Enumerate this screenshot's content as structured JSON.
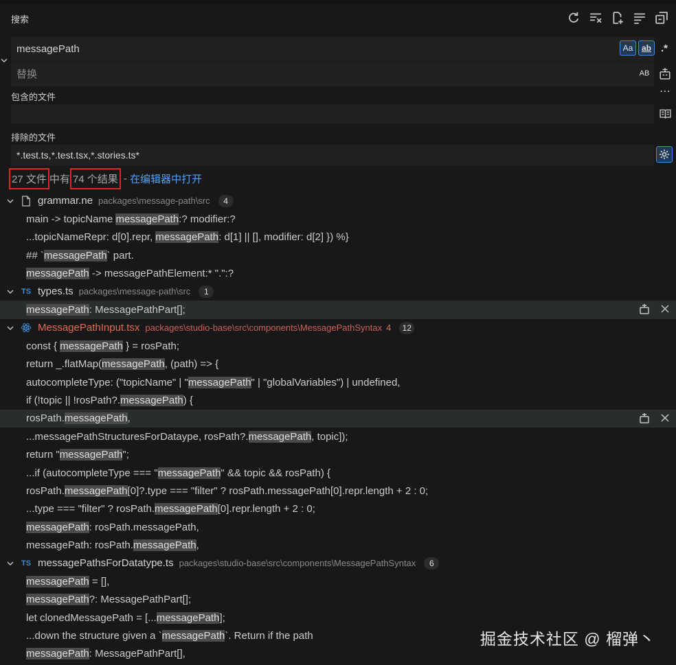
{
  "panel": {
    "title": "搜索"
  },
  "header_icons": [
    "refresh-icon",
    "clear-results-icon",
    "new-search-editor-icon",
    "view-as-tree-icon",
    "collapse-all-icon"
  ],
  "search": {
    "value": "messagePath",
    "opt_case": "Aa",
    "opt_word": "ab",
    "opt_regex": ".*"
  },
  "replace": {
    "placeholder": "替换",
    "opt_preserve_case": "AB"
  },
  "include": {
    "label": "包含的文件",
    "value": ""
  },
  "exclude": {
    "label": "排除的文件",
    "value": "*.test.ts,*.test.tsx,*.stories.ts*"
  },
  "summary": {
    "files": "27 文件",
    "middle": "中有",
    "results": "74 个结果",
    "sep": " - ",
    "open_link": "在编辑器中打开"
  },
  "files": [
    {
      "name": "grammar.ne",
      "path": "packages\\message-path\\src",
      "count": "4",
      "icon": "file-icon",
      "matches": [
        [
          [
            "main -> topicName ",
            false
          ],
          [
            "messagePath",
            true
          ],
          [
            ":? modifier:?",
            false
          ]
        ],
        [
          [
            "...topicNameRepr: d[0].repr, ",
            false
          ],
          [
            "messagePath",
            true
          ],
          [
            ": d[1] || [], modifier: d[2] }) %}",
            false
          ]
        ],
        [
          [
            "## `",
            false
          ],
          [
            "messagePath",
            true
          ],
          [
            "` part.",
            false
          ]
        ],
        [
          [
            "messagePath",
            true
          ],
          [
            " -> messagePathElement:* \".\":?",
            false
          ]
        ]
      ]
    },
    {
      "name": "types.ts",
      "path": "packages\\message-path\\src",
      "count": "1",
      "icon": "ts-icon",
      "icon_text": "TS",
      "matches": [
        [
          [
            "messagePath",
            true
          ],
          [
            ": MessagePathPart[];",
            false
          ]
        ]
      ]
    },
    {
      "name": "MessagePathInput.tsx",
      "path": "packages\\studio-base\\src\\components\\MessagePathSyntax",
      "mod": "4",
      "count": "12",
      "icon": "react-icon",
      "matches": [
        [
          [
            "const { ",
            false
          ],
          [
            "messagePath",
            true
          ],
          [
            " } = rosPath;",
            false
          ]
        ],
        [
          [
            "return _.flatMap(",
            false
          ],
          [
            "messagePath",
            true
          ],
          [
            ", (path) => {",
            false
          ]
        ],
        [
          [
            "autocompleteType: (\"topicName\" | \"",
            false
          ],
          [
            "messagePath",
            true
          ],
          [
            "\" | \"globalVariables\") | undefined,",
            false
          ]
        ],
        [
          [
            "if (!topic || !rosPath?.",
            false
          ],
          [
            "messagePath",
            true
          ],
          [
            ") {",
            false
          ]
        ],
        [
          [
            "rosPath.",
            false
          ],
          [
            "messagePath",
            true
          ],
          [
            ",",
            false
          ]
        ],
        [
          [
            "...messagePathStructuresForDataype, rosPath?.",
            false
          ],
          [
            "messagePath",
            true
          ],
          [
            ", topic]);",
            false
          ]
        ],
        [
          [
            "return \"",
            false
          ],
          [
            "messagePath",
            true
          ],
          [
            "\";",
            false
          ]
        ],
        [
          [
            "...if (autocompleteType === \"",
            false
          ],
          [
            "messagePath",
            true
          ],
          [
            "\" && topic && rosPath) {",
            false
          ]
        ],
        [
          [
            "rosPath.",
            false
          ],
          [
            "messagePath",
            true
          ],
          [
            "[0]?.type === \"filter\" ? rosPath.messagePath[0].repr.length + 2 : 0;",
            false
          ]
        ],
        [
          [
            "...type === \"filter\" ? rosPath.",
            false
          ],
          [
            "messagePath",
            true
          ],
          [
            "[0].repr.length + 2 : 0;",
            false
          ]
        ],
        [
          [
            "messagePath",
            true
          ],
          [
            ": rosPath.messagePath,",
            false
          ]
        ],
        [
          [
            "messagePath: rosPath.",
            false
          ],
          [
            "messagePath",
            true
          ],
          [
            ",",
            false
          ]
        ]
      ]
    },
    {
      "name": "messagePathsForDatatype.ts",
      "path": "packages\\studio-base\\src\\components\\MessagePathSyntax",
      "count": "6",
      "icon": "ts-icon",
      "icon_text": "TS",
      "matches": [
        [
          [
            "messagePath",
            true
          ],
          [
            " = [],",
            false
          ]
        ],
        [
          [
            "messagePath",
            true
          ],
          [
            "?: MessagePathPart[];",
            false
          ]
        ],
        [
          [
            "let clonedMessagePath = [...",
            false
          ],
          [
            "messagePath",
            true
          ],
          [
            "];",
            false
          ]
        ],
        [
          [
            "...down the structure given a `",
            false
          ],
          [
            "messagePath",
            true
          ],
          [
            "`. Return if the path",
            false
          ]
        ],
        [
          [
            "messagePath",
            true
          ],
          [
            ": MessagePathPart[],",
            false
          ]
        ]
      ]
    }
  ],
  "selected_rows": [
    "1-0",
    "2-4"
  ],
  "watermark": "掘金技术社区 @ 榴弹丶"
}
